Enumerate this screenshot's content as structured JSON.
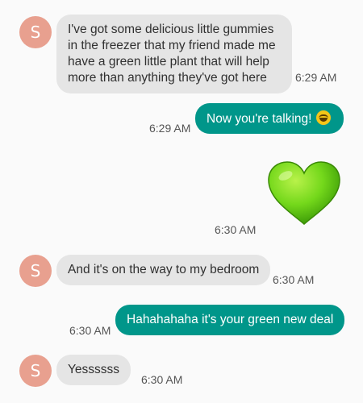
{
  "contact": {
    "initial": "S"
  },
  "messages": [
    {
      "id": "m1",
      "direction": "incoming",
      "text": "I've got some delicious little gummies in the freezer that my friend made me have a green little plant that will help more than anything they've got here",
      "time": "6:29 AM"
    },
    {
      "id": "m2",
      "direction": "outgoing",
      "text": "Now you're talking!",
      "emoji": "rolling-laughing-emoji",
      "time": "6:29 AM"
    },
    {
      "id": "m3",
      "direction": "outgoing",
      "emoji": "green-heart-emoji",
      "time": "6:30 AM"
    },
    {
      "id": "m4",
      "direction": "incoming",
      "text": "And it's on the way to my bedroom",
      "time": "6:30 AM"
    },
    {
      "id": "m5",
      "direction": "outgoing",
      "text": "Hahahahaha it's your green new deal",
      "time": "6:30 AM"
    },
    {
      "id": "m6",
      "direction": "incoming",
      "text": "Yessssss",
      "time": "6:30 AM"
    }
  ],
  "colors": {
    "background": "#fafafa",
    "incoming_bubble": "#e5e5e5",
    "outgoing_bubble": "#00968a",
    "avatar": "#e8a08f",
    "heart": "#66cc1a"
  }
}
